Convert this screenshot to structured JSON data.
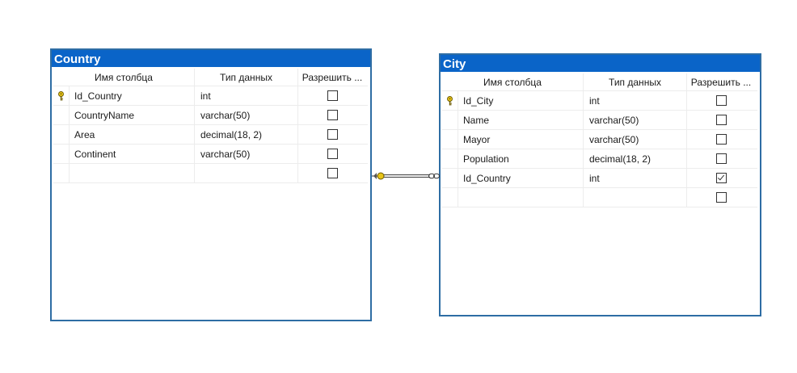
{
  "colors": {
    "title_bar": "#0a64c8",
    "border": "#2e6da4",
    "key_icon": "#e8c417",
    "connector": "#555555"
  },
  "tables": [
    {
      "title": "Country",
      "headers": [
        "Имя столбца",
        "Тип данных",
        "Разрешить ..."
      ],
      "rows": [
        {
          "key": true,
          "name": "Id_Country",
          "type": "int",
          "allow_null": false
        },
        {
          "key": false,
          "name": "CountryName",
          "type": "varchar(50)",
          "allow_null": false
        },
        {
          "key": false,
          "name": "Area",
          "type": "decimal(18, 2)",
          "allow_null": false
        },
        {
          "key": false,
          "name": "Continent",
          "type": "varchar(50)",
          "allow_null": false
        },
        {
          "key": false,
          "name": "",
          "type": "",
          "allow_null": false
        }
      ]
    },
    {
      "title": "City",
      "headers": [
        "Имя столбца",
        "Тип данных",
        "Разрешить ..."
      ],
      "rows": [
        {
          "key": true,
          "name": "Id_City",
          "type": "int",
          "allow_null": false
        },
        {
          "key": false,
          "name": "Name",
          "type": "varchar(50)",
          "allow_null": false
        },
        {
          "key": false,
          "name": "Mayor",
          "type": "varchar(50)",
          "allow_null": false
        },
        {
          "key": false,
          "name": "Population",
          "type": "decimal(18, 2)",
          "allow_null": false
        },
        {
          "key": false,
          "name": "Id_Country",
          "type": "int",
          "allow_null": true
        },
        {
          "key": false,
          "name": "",
          "type": "",
          "allow_null": false
        }
      ]
    }
  ],
  "relationship": {
    "from": "Country",
    "to": "City",
    "from_end": "key-icon",
    "to_end": "infinity-icon"
  }
}
